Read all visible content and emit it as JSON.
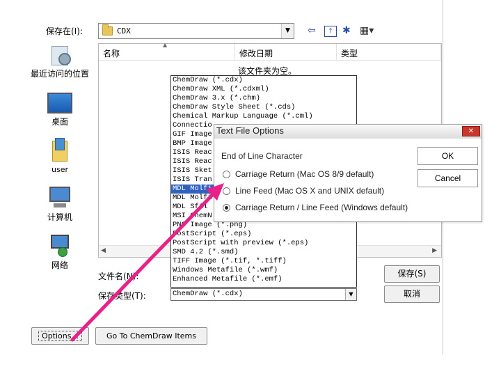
{
  "save_dialog": {
    "save_in_label": "保存在(I):",
    "save_in_value": "CDX",
    "places": [
      {
        "label": "最近访问的位置",
        "icon": "recent-places-icon"
      },
      {
        "label": "桌面",
        "icon": "desktop-icon"
      },
      {
        "label": "user",
        "icon": "user-folder-icon"
      },
      {
        "label": "计算机",
        "icon": "computer-icon"
      },
      {
        "label": "网络",
        "icon": "network-icon"
      }
    ],
    "columns": {
      "name": "名称",
      "date": "修改日期",
      "type": "类型"
    },
    "empty_message": "该文件夹为空。",
    "file_name_label": "文件名(N):",
    "file_type_label": "保存类型(T):",
    "file_type_value": "ChemDraw (*.cdx)",
    "save_button": "保存(S)",
    "cancel_button": "取消",
    "options_button": "Options...",
    "chemdraw_items_button": "Go To ChemDraw Items",
    "toolbar_icons": [
      "back-arrow-icon",
      "up-folder-icon",
      "new-folder-icon",
      "view-menu-icon"
    ]
  },
  "file_types": [
    "ChemDraw (*.cdx)",
    "ChemDraw XML (*.cdxml)",
    "ChemDraw 3.x (*.chm)",
    "ChemDraw Style Sheet (*.cds)",
    "Chemical Markup Language (*.cml)",
    "Connectio",
    "GIF Image",
    "BMP Image",
    "ISIS Reac",
    "ISIS Reac",
    "ISIS Sket",
    "ISIS Tran",
    "MDL Molfi",
    "MDL Molfi",
    "MDL Sfil",
    "MSI ChemN",
    "PNG Image (*.png)",
    "PostScript (*.eps)",
    "PostScript with preview (*.eps)",
    "SMD 4.2 (*.smd)",
    "TIFF Image (*.tif, *.tiff)",
    "Windows Metafile (*.wmf)",
    "Enhanced Metafile (*.emf)"
  ],
  "selected_file_type_index": 12,
  "text_file_options": {
    "title": "Text File Options",
    "group_label": "End of Line Character",
    "options": [
      {
        "label": "Carriage Return (Mac OS 8/9 default)",
        "checked": false
      },
      {
        "label": "Line Feed (Mac OS X and UNIX default)",
        "checked": false
      },
      {
        "label": "Carriage Return / Line Feed (Windows default)",
        "checked": true
      }
    ],
    "ok": "OK",
    "cancel": "Cancel",
    "close_symbol": "✕"
  },
  "colors": {
    "annotation_arrow": "#e8208a",
    "selection": "#3060c0",
    "close_button": "#c8392c"
  }
}
